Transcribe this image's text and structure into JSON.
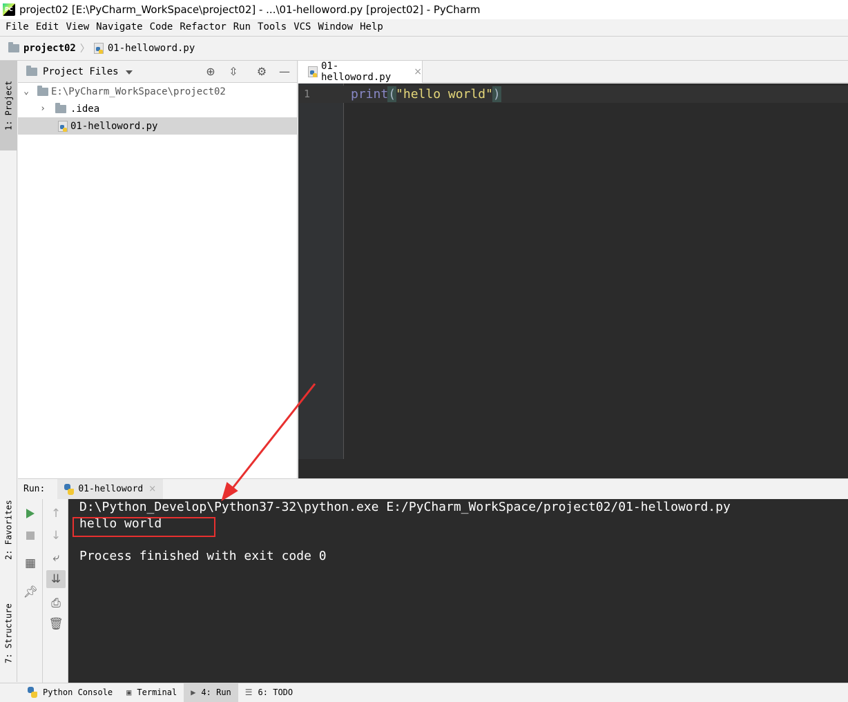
{
  "window": {
    "title": "project02 [E:\\PyCharm_WorkSpace\\project02] - ...\\01-helloword.py [project02] - PyCharm",
    "app_icon_text": "PC"
  },
  "menu": [
    "File",
    "Edit",
    "View",
    "Navigate",
    "Code",
    "Refactor",
    "Run",
    "Tools",
    "VCS",
    "Window",
    "Help"
  ],
  "navbar": {
    "project": "project02",
    "file": "01-helloword.py"
  },
  "left_strip": {
    "project_tab": "1: Project",
    "favorites_tab": "2: Favorites",
    "structure_tab": "7: Structure"
  },
  "project_panel": {
    "header": "Project Files",
    "tree": [
      {
        "label": "E:\\PyCharm_WorkSpace\\project02",
        "type": "root",
        "expanded": true
      },
      {
        "label": ".idea",
        "type": "folder",
        "expanded": false
      },
      {
        "label": "01-helloword.py",
        "type": "file",
        "selected": true
      }
    ]
  },
  "editor": {
    "tab_label": "01-helloword.py",
    "tab_close": "×",
    "line_number": "1",
    "code": {
      "func": "print",
      "open": "(",
      "string": "\"hello world\"",
      "close": ")"
    }
  },
  "run_panel": {
    "label": "Run:",
    "tab_label": "01-helloword",
    "tab_close": "×",
    "console_lines": [
      "D:\\Python_Develop\\Python37-32\\python.exe E:/PyCharm_WorkSpace/project02/01-helloword.py",
      "hello world",
      "",
      "Process finished with exit code 0"
    ]
  },
  "bottom_tabs": [
    {
      "label": "Python Console",
      "icon": "python-icon"
    },
    {
      "label": "Terminal",
      "icon": "terminal-icon"
    },
    {
      "label": "4: Run",
      "icon": "run-icon",
      "active": true
    },
    {
      "label": "6: TODO",
      "icon": "todo-icon"
    }
  ],
  "colors": {
    "editor_bg": "#2b2b2b",
    "print_kw": "#8888c6",
    "string": "#e6d87a",
    "annotation_red": "#e8302f",
    "run_green": "#499c54"
  }
}
